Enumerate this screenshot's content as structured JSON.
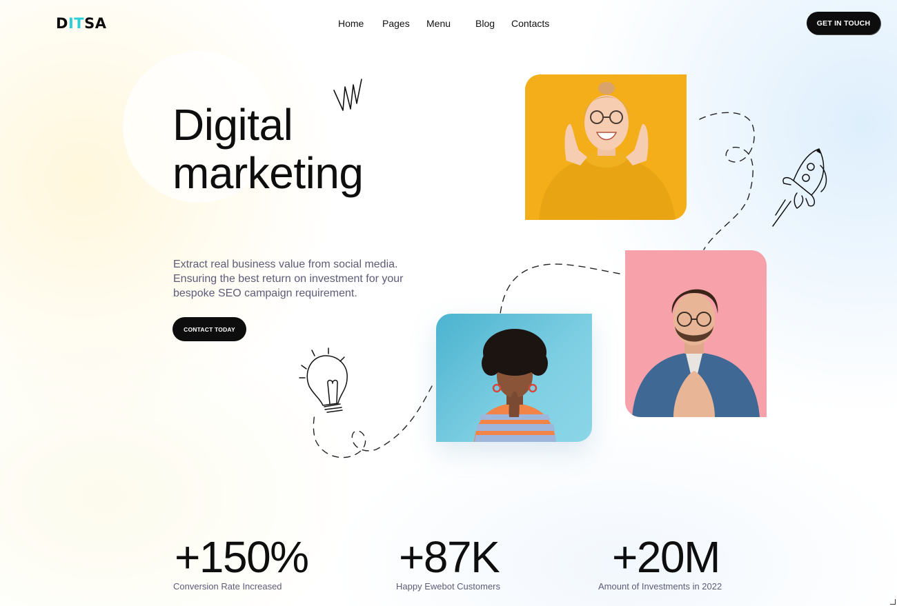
{
  "header": {
    "logo": {
      "part1": "D",
      "accent": "IT",
      "part2": "SA"
    },
    "nav": [
      {
        "label": "Home"
      },
      {
        "label": "Pages"
      },
      {
        "label": "Menu"
      },
      {
        "label": "Blog"
      },
      {
        "label": "Contacts"
      }
    ],
    "cta_label": "GET IN TOUCH"
  },
  "hero": {
    "title_line1": "Digital",
    "title_line2": "marketing",
    "description_lines": [
      "Extract real business value from social media.",
      "Ensuring the best return on investment for your",
      "bespoke SEO campaign requirement."
    ],
    "cta_label": "CONTACT TODAY"
  },
  "stats": [
    {
      "value": "+150%",
      "label": "Conversion Rate Increased"
    },
    {
      "value": "+87K",
      "label": "Happy Ewebot Customers"
    },
    {
      "value": "+20M",
      "label": "Amount of Investments in 2022"
    }
  ],
  "colors": {
    "accent": "#2ccfd8",
    "button": "#0d0d0d",
    "muted_text": "#5c5b77",
    "photo_yellow": "#f4ae1a",
    "photo_pink": "#f7a1aa",
    "photo_blue": "#4bb3cf"
  },
  "icons": [
    "rocket-icon",
    "lightbulb-icon",
    "scribble-icon"
  ]
}
